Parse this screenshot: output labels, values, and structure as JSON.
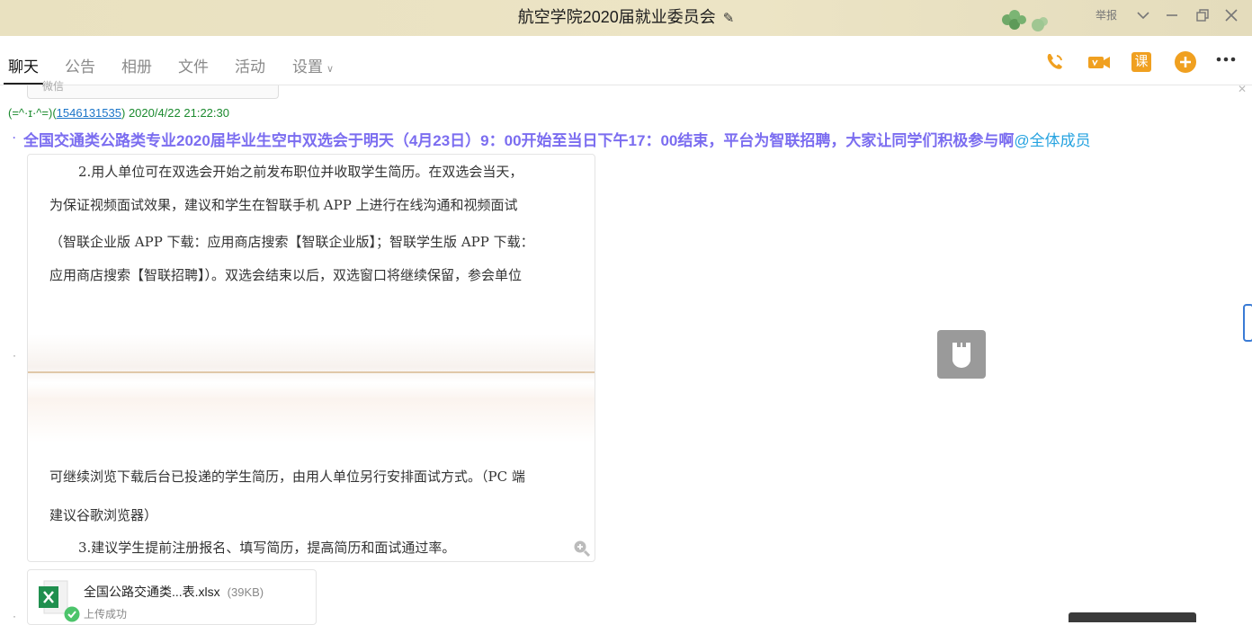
{
  "window": {
    "title": "航空学院2020届就业委员会",
    "report_label": "举报"
  },
  "tabs": [
    {
      "label": "聊天"
    },
    {
      "label": "公告"
    },
    {
      "label": "相册"
    },
    {
      "label": "文件"
    },
    {
      "label": "活动"
    },
    {
      "label": "设置"
    }
  ],
  "toolbar": {
    "icons": [
      "phone-icon",
      "video-icon",
      "course-icon",
      "add-icon",
      "more-icon"
    ],
    "course_label": "课"
  },
  "message": {
    "partial_card_label": "微信",
    "sender_nick": "(=^·ɪ·^=)",
    "sender_qq": "1546131535",
    "timestamp": "2020/4/22 21:22:30",
    "announcement": "全国交通类公路类专业2020届毕业生空中双选会于明天（4月23日）9：00开始至当日下午17：00结束，平台为智联招聘，大家让同学们积极参与啊",
    "mention": "@全体成员",
    "doc_lines": [
      "2.用人单位可在双选会开始之前发布职位并收取学生简历。在双选会当天，",
      "为保证视频面试效果，建议和学生在智联手机 APP 上进行在线沟通和视频面试",
      "（智联企业版 APP 下载：应用商店搜索【智联企业版】；智联学生版 APP 下载：",
      "应用商店搜索【智联招聘】）。双选会结束以后，双选窗口将继续保留，参会单位",
      "可继续浏览下载后台已投递的学生简历，由用人单位另行安排面试方式。（PC 端",
      "建议谷歌浏览器）",
      "3.建议学生提前注册报名、填写简历，提高简历和面试通过率。"
    ]
  },
  "file": {
    "name": "全国公路交通类...表.xlsx",
    "size": "(39KB)",
    "status": "上传成功"
  },
  "colors": {
    "titlebar": "#ece4c5",
    "announcement": "#7b6df0",
    "mention": "#26a3e0",
    "toolbar_orange": "#f0a020"
  }
}
